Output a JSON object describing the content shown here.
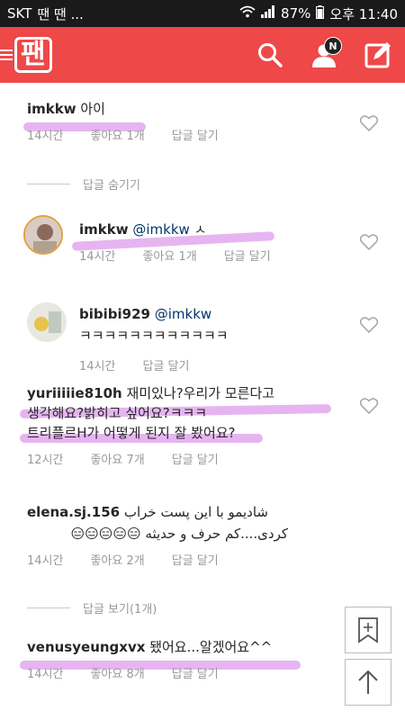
{
  "statusbar": {
    "carrier": "SKT",
    "app_icons": "땐 땐 ...",
    "battery": "87%",
    "time": "오후 11:40"
  },
  "appbar": {
    "logo": "팬",
    "brand_color": "#ef4848",
    "notification_badge": "N"
  },
  "comments": [
    {
      "user": "imkkw",
      "handle": "",
      "text": "아이",
      "time": "14시간",
      "likes": "좋아요 1개",
      "reply": "답글 달기"
    },
    {
      "user": "imkkw",
      "handle": "@imkkw",
      "text": "ㅅ",
      "time": "14시간",
      "likes": "좋아요 1개",
      "reply": "답글 달기"
    },
    {
      "user": "bibibi929",
      "handle": "@imkkw",
      "text": "ㅋㅋㅋㅋㅋㅋㅋㅋㅋㅋㅋㅋ",
      "time": "14시간",
      "likes": "",
      "reply": "답글 달기"
    },
    {
      "user": "yuriiiiie810h",
      "text_line1": "재미있나?우리가 모른다고",
      "text_line2": "생각해요?밝히고 싶어요?ㅋㅋㅋ",
      "text_line3": "트리플르H가 어떻게 된지 잘 봤어요?",
      "time": "12시간",
      "likes": "좋아요 7개",
      "reply": "답글 달기"
    },
    {
      "user": "elena.sj.156",
      "text_line1": "شادیمو با این پست خراب",
      "text_line2": "کردی....کم حرف و حدیثه 😑😑😑😑😑",
      "time": "14시간",
      "likes": "좋아요 2개",
      "reply": "답글 달기"
    },
    {
      "user": "venusyeungxvx",
      "text": "됐어요...알겠어요^^",
      "time": "14시간",
      "likes": "좋아요 8개",
      "reply": "답글 달기"
    }
  ],
  "reply_toggles": {
    "hide": "답글 숨기기",
    "show": "답글 보기(1개)"
  }
}
